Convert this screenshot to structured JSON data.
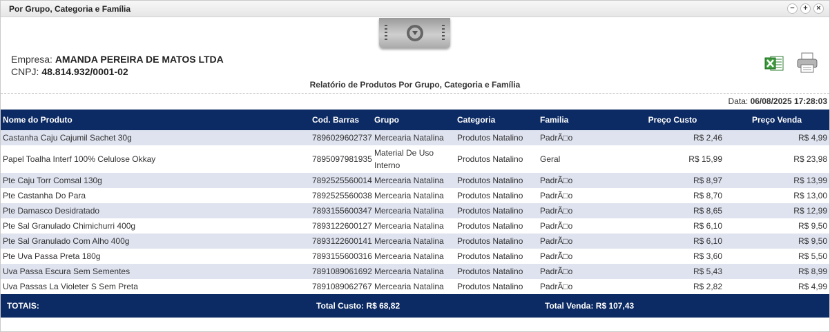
{
  "window": {
    "title": "Por Grupo, Categoria e Família",
    "controls": [
      "−",
      "+",
      "×"
    ]
  },
  "company": {
    "empresa_label": "Empresa:",
    "empresa_value": "AMANDA PEREIRA DE MATOS LTDA",
    "cnpj_label": "CNPJ:",
    "cnpj_value": "48.814.932/0001-02"
  },
  "icons": {
    "excel": "excel-icon",
    "print": "print-icon",
    "collapse": "chevron-down-icon"
  },
  "report": {
    "title": "Relatório de Produtos Por Grupo, Categoria e Família",
    "date_label": "Data:",
    "date_value": "06/08/2025 17:28:03"
  },
  "table": {
    "headers": [
      "Nome do Produto",
      "Cod. Barras",
      "Grupo",
      "Categoria",
      "Familia",
      "Preço Custo",
      "Preço Venda"
    ],
    "rows": [
      [
        "Castanha Caju Cajumil Sachet 30g",
        "7896029602737",
        "Mercearia Natalina",
        "Produtos Natalino",
        "PadrÃ□o",
        "R$ 2,46",
        "R$ 4,99"
      ],
      [
        "Papel Toalha Interf 100% Celulose Okkay",
        "7895097981935",
        "Material De Uso Interno",
        "Produtos Natalino",
        "Geral",
        "R$ 15,99",
        "R$ 23,98"
      ],
      [
        "Pte Caju Torr Comsal 130g",
        "7892525560014",
        "Mercearia Natalina",
        "Produtos Natalino",
        "PadrÃ□o",
        "R$ 8,97",
        "R$ 13,99"
      ],
      [
        "Pte Castanha Do Para",
        "7892525560038",
        "Mercearia Natalina",
        "Produtos Natalino",
        "PadrÃ□o",
        "R$ 8,70",
        "R$ 13,00"
      ],
      [
        "Pte Damasco Desidratado",
        "7893155600347",
        "Mercearia Natalina",
        "Produtos Natalino",
        "PadrÃ□o",
        "R$ 8,65",
        "R$ 12,99"
      ],
      [
        "Pte Sal Granulado Chimichurri 400g",
        "7893122600127",
        "Mercearia Natalina",
        "Produtos Natalino",
        "PadrÃ□o",
        "R$ 6,10",
        "R$ 9,50"
      ],
      [
        "Pte Sal Granulado Com Alho 400g",
        "7893122600141",
        "Mercearia Natalina",
        "Produtos Natalino",
        "PadrÃ□o",
        "R$ 6,10",
        "R$ 9,50"
      ],
      [
        "Pte Uva Passa Preta 180g",
        "7893155600316",
        "Mercearia Natalina",
        "Produtos Natalino",
        "PadrÃ□o",
        "R$ 3,60",
        "R$ 5,50"
      ],
      [
        "Uva Passa Escura Sem Sementes",
        "7891089061692",
        "Mercearia Natalina",
        "Produtos Natalino",
        "PadrÃ□o",
        "R$ 5,43",
        "R$ 8,99"
      ],
      [
        "Uva Passas La Violeter S Sem Preta",
        "7891089062767",
        "Mercearia Natalina",
        "Produtos Natalino",
        "PadrÃ□o",
        "R$ 2,82",
        "R$ 4,99"
      ]
    ]
  },
  "totals": {
    "label": "TOTAIS:",
    "custo": "Total Custo: R$ 68,82",
    "venda": "Total Venda: R$ 107,43"
  },
  "colors": {
    "header_bg": "#0c2a63",
    "row_alt": "#dfe3ef"
  }
}
